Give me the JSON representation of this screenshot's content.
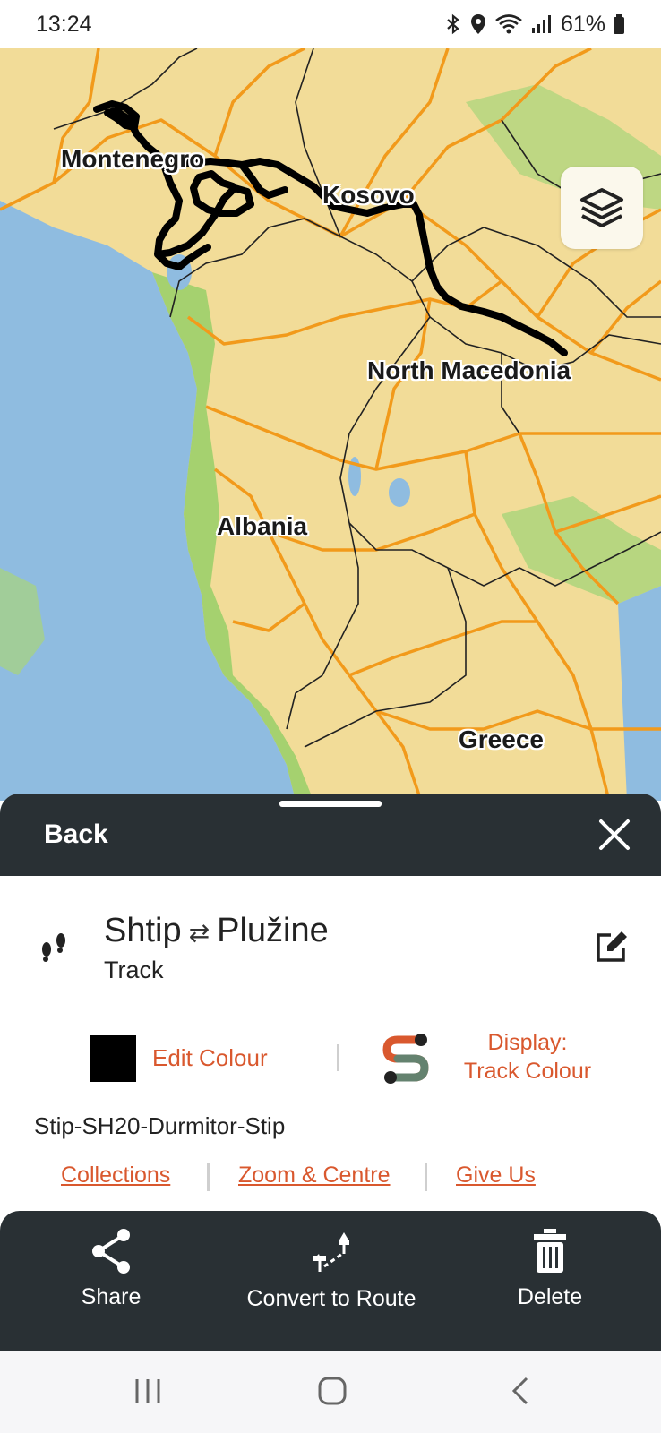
{
  "status_bar": {
    "time": "13:24",
    "battery": "61%",
    "icons": [
      "bluetooth-icon",
      "location-icon",
      "wifi-icon",
      "signal-icon",
      "battery-icon"
    ]
  },
  "map": {
    "labels": {
      "montenegro": "Montenegro",
      "kosovo": "Kosovo",
      "north_macedonia": "North Macedonia",
      "albania": "Albania",
      "greece": "Greece"
    },
    "colors": {
      "land": "#f2dc98",
      "water": "#8fbce0",
      "lowland": "#9ccf6a",
      "roads": "#f29a1b",
      "track": "#000000"
    }
  },
  "sheet": {
    "back_label": "Back",
    "item": {
      "from": "Shtip",
      "arrow": "⇄",
      "to": "Plužine",
      "type": "Track"
    },
    "edit_colour_label": "Edit Colour",
    "track_colour": "#000000",
    "display_label_line1": "Display:",
    "display_label_line2": "Track Colour",
    "track_name": "Stip-SH20-Durmitor-Stip",
    "links": {
      "collections": "Collections",
      "zoom_centre": "Zoom & Centre",
      "give_us": "Give Us"
    },
    "accent": "#d9582e"
  },
  "action_bar": {
    "share": "Share",
    "convert": "Convert to Route",
    "delete": "Delete"
  }
}
